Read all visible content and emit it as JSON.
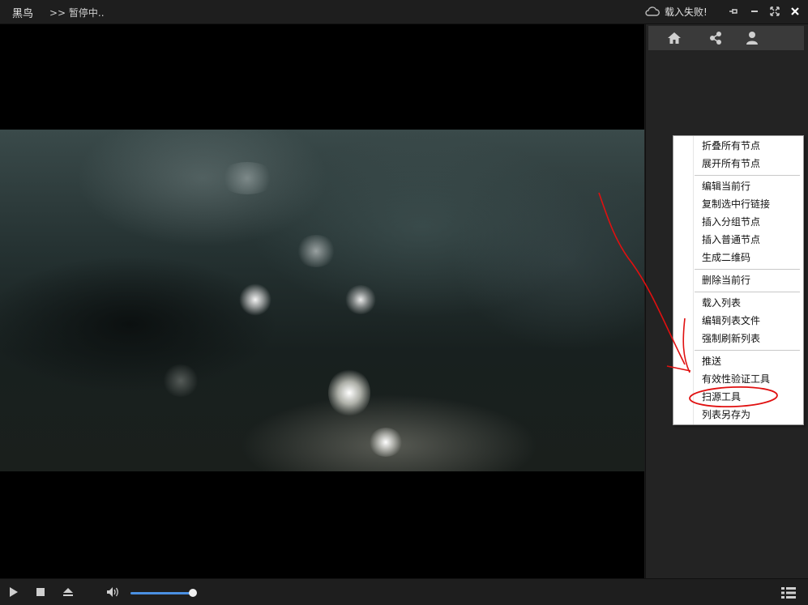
{
  "titlebar": {
    "app_name": "黑鸟",
    "status": ">> 暂停中..",
    "load_status": "载入失败!",
    "icons": [
      "cloud-icon",
      "pin-icon",
      "minimize-icon",
      "maximize-icon",
      "close-icon"
    ]
  },
  "sidebar": {
    "toolbar_icons": [
      "home-icon",
      "share-icon",
      "user-icon"
    ]
  },
  "context_menu": {
    "items": [
      "折叠所有节点",
      "展开所有节点",
      "编辑当前行",
      "复制选中行链接",
      "插入分组节点",
      "插入普通节点",
      "生成二维码",
      "删除当前行",
      "载入列表",
      "编辑列表文件",
      "强制刷新列表",
      "推送",
      "有效性验证工具",
      "扫源工具",
      "列表另存为"
    ],
    "highlighted_item": "扫源工具"
  },
  "controls": {
    "icons": [
      "play-icon",
      "stop-icon",
      "eject-icon",
      "volume-icon",
      "playlist-icon"
    ],
    "volume_level": 0.95
  },
  "colors": {
    "accent": "#4a90e2",
    "annotation": "#e01010",
    "background": "#1c1c1c",
    "menu_bg": "#ffffff"
  }
}
